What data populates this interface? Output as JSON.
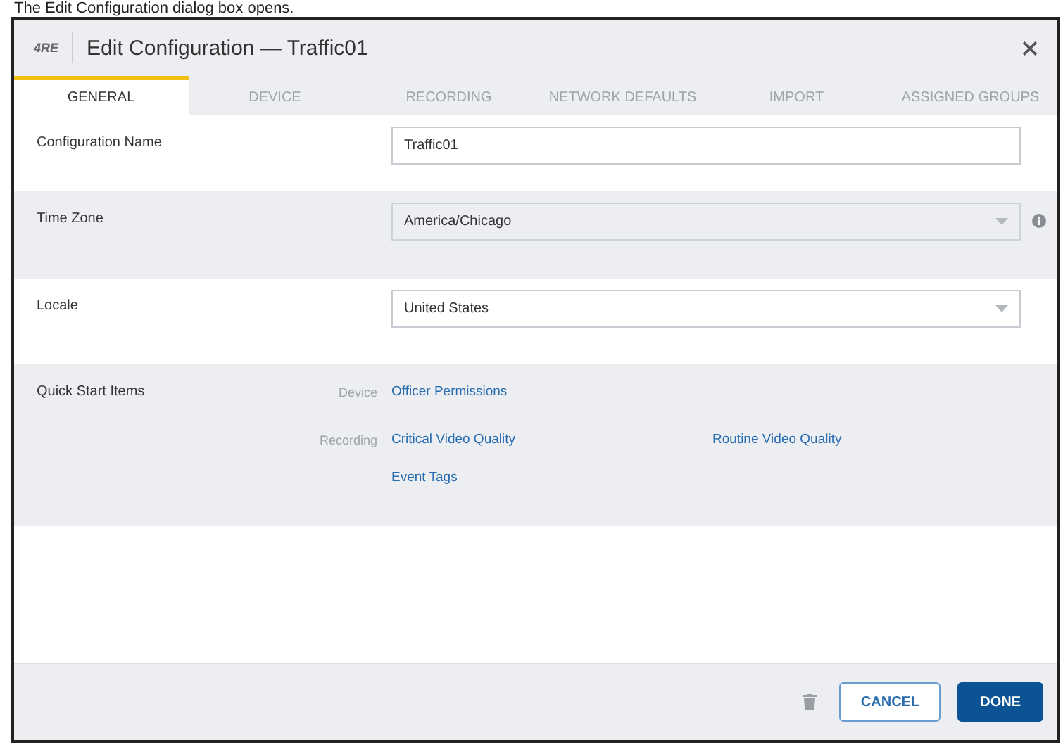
{
  "caption": "The Edit Configuration dialog box opens.",
  "dialog": {
    "logo": "4RE",
    "title": "Edit Configuration — Traffic01"
  },
  "tabs": [
    {
      "label": "GENERAL",
      "selected": true
    },
    {
      "label": "DEVICE",
      "selected": false
    },
    {
      "label": "RECORDING",
      "selected": false
    },
    {
      "label": "NETWORK DEFAULTS",
      "selected": false
    },
    {
      "label": "IMPORT",
      "selected": false
    },
    {
      "label": "ASSIGNED GROUPS",
      "selected": false
    }
  ],
  "fields": [
    {
      "kind": "text",
      "label": "Configuration Name",
      "value": "Traffic01"
    },
    {
      "kind": "select",
      "label": "Time Zone",
      "value": "America/Chicago",
      "disabled": true,
      "info": true
    },
    {
      "kind": "select",
      "label": "Locale",
      "value": "United States",
      "disabled": false,
      "info": false
    }
  ],
  "quick_start": {
    "label": "Quick Start Items",
    "groups": [
      {
        "name": "Device",
        "links": [
          "Officer Permissions"
        ]
      },
      {
        "name": "Recording",
        "links": [
          "Critical Video Quality",
          "Routine Video Quality",
          "Event Tags"
        ]
      }
    ]
  },
  "footer": {
    "cancel": "CANCEL",
    "done": "DONE"
  }
}
